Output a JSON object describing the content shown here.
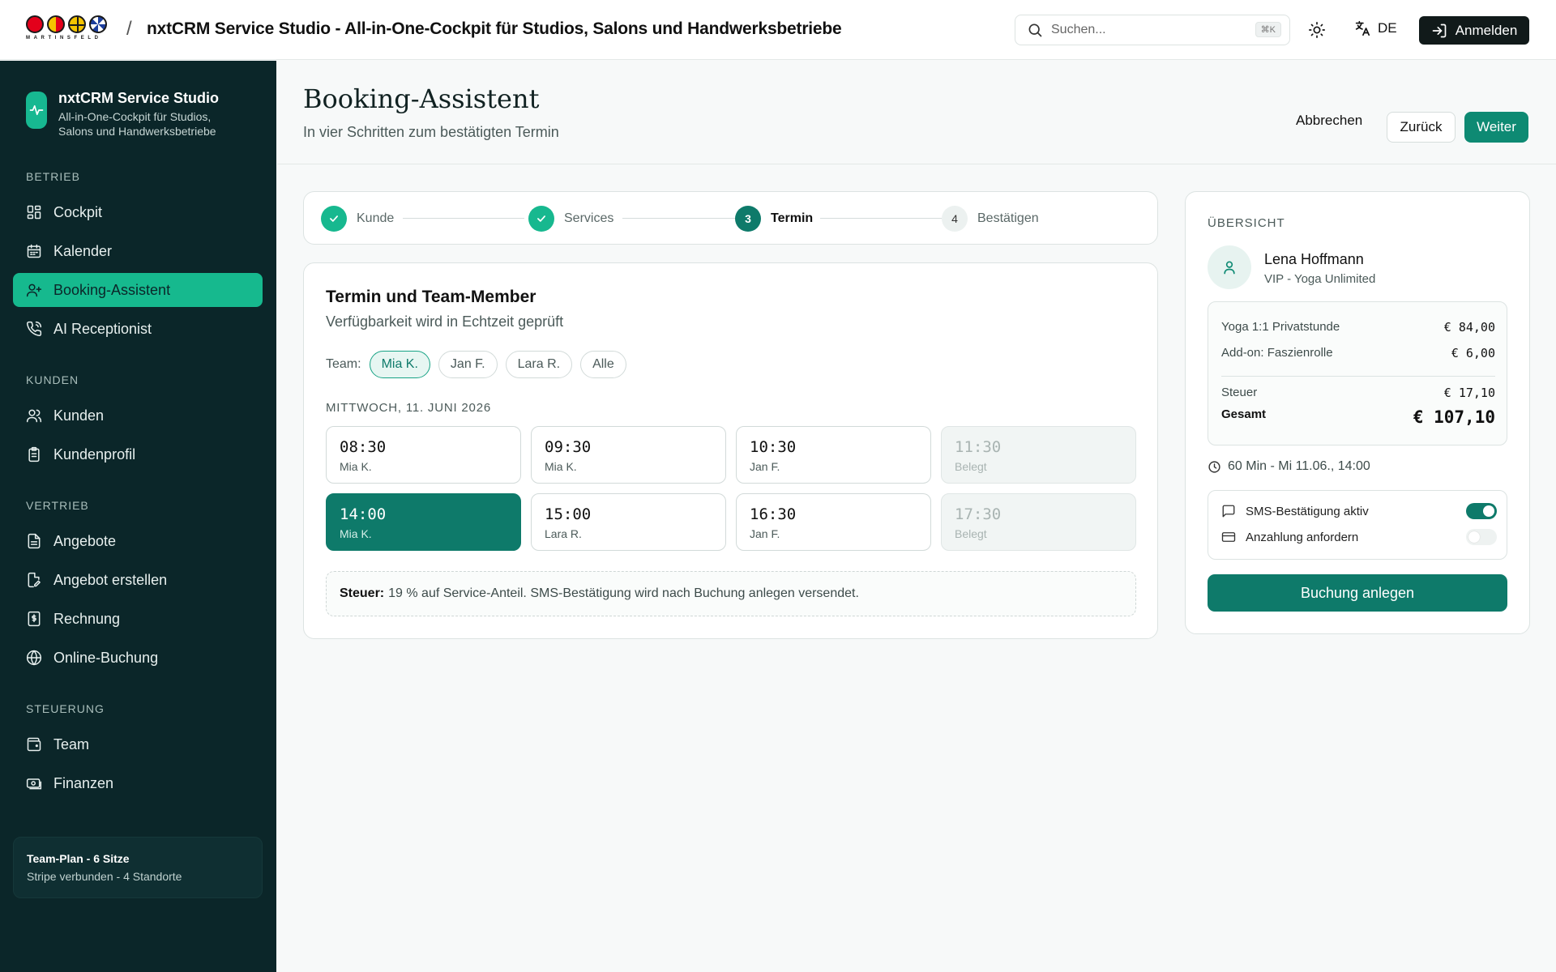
{
  "topbar": {
    "logo_word": "MARTINSFELD",
    "separator": "/",
    "title": "nxtCRM Service Studio - All-in-One-Cockpit für Studios, Salons und Handwerksbetriebe",
    "search_placeholder": "Suchen...",
    "search_shortcut": "⌘K",
    "language": "DE",
    "login_label": "Anmelden"
  },
  "sidebar": {
    "brand_name": "nxtCRM Service Studio",
    "brand_sub": "All-in-One-Cockpit für Studios, Salons und Handwerksbetriebe",
    "sections": [
      {
        "label": "BETRIEB",
        "items": [
          {
            "label": "Cockpit",
            "icon": "dashboard-icon"
          },
          {
            "label": "Kalender",
            "icon": "calendar-icon"
          },
          {
            "label": "Booking-Assistent",
            "icon": "user-plus-icon",
            "active": true
          },
          {
            "label": "AI Receptionist",
            "icon": "phone-icon"
          }
        ]
      },
      {
        "label": "KUNDEN",
        "items": [
          {
            "label": "Kunden",
            "icon": "users-icon"
          },
          {
            "label": "Kundenprofil",
            "icon": "clipboard-icon"
          }
        ]
      },
      {
        "label": "VERTRIEB",
        "items": [
          {
            "label": "Angebote",
            "icon": "document-icon"
          },
          {
            "label": "Angebot erstellen",
            "icon": "edit-document-icon"
          },
          {
            "label": "Rechnung",
            "icon": "invoice-icon"
          },
          {
            "label": "Online-Buchung",
            "icon": "globe-icon"
          }
        ]
      },
      {
        "label": "STEUERUNG",
        "items": [
          {
            "label": "Team",
            "icon": "wallet-icon"
          },
          {
            "label": "Finanzen",
            "icon": "cash-icon"
          }
        ]
      }
    ],
    "plan_title": "Team-Plan - 6 Sitze",
    "plan_sub": "Stripe verbunden - 4 Standorte"
  },
  "header": {
    "title": "Booking-Assistent",
    "subtitle": "In vier Schritten zum bestätigten Termin",
    "cancel_label": "Abbrechen",
    "back_label": "Zurück",
    "next_label": "Weiter"
  },
  "stepper": {
    "steps": [
      {
        "number": "1",
        "label": "Kunde",
        "state": "done"
      },
      {
        "number": "2",
        "label": "Services",
        "state": "done"
      },
      {
        "number": "3",
        "label": "Termin",
        "state": "current"
      },
      {
        "number": "4",
        "label": "Bestätigen",
        "state": "todo"
      }
    ]
  },
  "termin": {
    "title": "Termin und Team-Member",
    "subtitle": "Verfügbarkeit wird in Echtzeit geprüft",
    "team_label": "Team:",
    "team_chips": [
      "Mia K.",
      "Jan F.",
      "Lara R.",
      "Alle"
    ],
    "selected_chip": "Mia K.",
    "date_label": "MITTWOCH, 11. JUNI 2026",
    "slots": [
      {
        "time": "08:30",
        "who": "Mia K.",
        "state": "free"
      },
      {
        "time": "09:30",
        "who": "Mia K.",
        "state": "free"
      },
      {
        "time": "10:30",
        "who": "Jan F.",
        "state": "free"
      },
      {
        "time": "11:30",
        "who": "Belegt",
        "state": "busy"
      },
      {
        "time": "14:00",
        "who": "Mia K.",
        "state": "selected"
      },
      {
        "time": "15:00",
        "who": "Lara R.",
        "state": "free"
      },
      {
        "time": "16:30",
        "who": "Jan F.",
        "state": "free"
      },
      {
        "time": "17:30",
        "who": "Belegt",
        "state": "busy"
      }
    ],
    "note_bold": "Steuer:",
    "note_text": "19 % auf Service-Anteil. SMS-Bestätigung wird nach Buchung anlegen versendet."
  },
  "summary": {
    "label": "ÜBERSICHT",
    "customer_name": "Lena Hoffmann",
    "customer_sub": "VIP - Yoga Unlimited",
    "lines": [
      {
        "label": "Yoga 1:1 Privatstunde",
        "value": "€ 84,00"
      },
      {
        "label": "Add-on: Faszienrolle",
        "value": "€ 6,00"
      }
    ],
    "tax_label": "Steuer",
    "tax_value": "€ 17,10",
    "total_label": "Gesamt",
    "total_value": "€ 107,10",
    "duration": "60 Min - Mi 11.06., 14:00",
    "sms_label": "SMS-Bestätigung aktiv",
    "sms_on": true,
    "deposit_label": "Anzahlung anfordern",
    "deposit_on": false,
    "book_label": "Buchung anlegen"
  },
  "colors": {
    "sidebar_bg": "#0b2629",
    "accent": "#16b98e",
    "primary": "#0e7a6a"
  }
}
